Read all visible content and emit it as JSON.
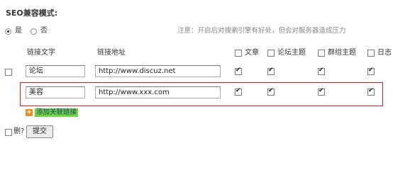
{
  "seo": {
    "title": "SEO兼容模式:",
    "option_yes": "是",
    "option_no": "否",
    "selected": "是",
    "note": "注意：开启后对搜索引擎有好处，但会对服务器造成压力"
  },
  "table": {
    "col_text": "链接文字",
    "col_url": "链接地址",
    "categories": [
      {
        "label": "文章"
      },
      {
        "label": "论坛主题"
      },
      {
        "label": "群组主题"
      },
      {
        "label": "日志"
      }
    ],
    "rows": [
      {
        "text": "论坛",
        "url": "http://www.discuz.net",
        "checks": [
          true,
          true,
          true,
          true
        ]
      },
      {
        "text": "美容",
        "url": "http://www.xxx.com",
        "checks": [
          true,
          true,
          true,
          true
        ]
      }
    ]
  },
  "add_link_label": "添加关联链接",
  "delete_label": "删?",
  "submit_label": "提交"
}
